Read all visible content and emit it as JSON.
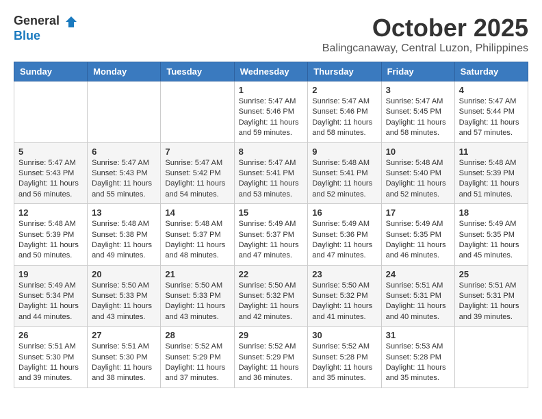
{
  "logo": {
    "text_general": "General",
    "text_blue": "Blue"
  },
  "title": {
    "month": "October 2025",
    "location": "Balingcanaway, Central Luzon, Philippines"
  },
  "headers": [
    "Sunday",
    "Monday",
    "Tuesday",
    "Wednesday",
    "Thursday",
    "Friday",
    "Saturday"
  ],
  "weeks": [
    [
      {
        "day": "",
        "sunrise": "",
        "sunset": "",
        "daylight": ""
      },
      {
        "day": "",
        "sunrise": "",
        "sunset": "",
        "daylight": ""
      },
      {
        "day": "",
        "sunrise": "",
        "sunset": "",
        "daylight": ""
      },
      {
        "day": "1",
        "sunrise": "Sunrise: 5:47 AM",
        "sunset": "Sunset: 5:46 PM",
        "daylight": "Daylight: 11 hours and 59 minutes."
      },
      {
        "day": "2",
        "sunrise": "Sunrise: 5:47 AM",
        "sunset": "Sunset: 5:46 PM",
        "daylight": "Daylight: 11 hours and 58 minutes."
      },
      {
        "day": "3",
        "sunrise": "Sunrise: 5:47 AM",
        "sunset": "Sunset: 5:45 PM",
        "daylight": "Daylight: 11 hours and 58 minutes."
      },
      {
        "day": "4",
        "sunrise": "Sunrise: 5:47 AM",
        "sunset": "Sunset: 5:44 PM",
        "daylight": "Daylight: 11 hours and 57 minutes."
      }
    ],
    [
      {
        "day": "5",
        "sunrise": "Sunrise: 5:47 AM",
        "sunset": "Sunset: 5:43 PM",
        "daylight": "Daylight: 11 hours and 56 minutes."
      },
      {
        "day": "6",
        "sunrise": "Sunrise: 5:47 AM",
        "sunset": "Sunset: 5:43 PM",
        "daylight": "Daylight: 11 hours and 55 minutes."
      },
      {
        "day": "7",
        "sunrise": "Sunrise: 5:47 AM",
        "sunset": "Sunset: 5:42 PM",
        "daylight": "Daylight: 11 hours and 54 minutes."
      },
      {
        "day": "8",
        "sunrise": "Sunrise: 5:47 AM",
        "sunset": "Sunset: 5:41 PM",
        "daylight": "Daylight: 11 hours and 53 minutes."
      },
      {
        "day": "9",
        "sunrise": "Sunrise: 5:48 AM",
        "sunset": "Sunset: 5:41 PM",
        "daylight": "Daylight: 11 hours and 52 minutes."
      },
      {
        "day": "10",
        "sunrise": "Sunrise: 5:48 AM",
        "sunset": "Sunset: 5:40 PM",
        "daylight": "Daylight: 11 hours and 52 minutes."
      },
      {
        "day": "11",
        "sunrise": "Sunrise: 5:48 AM",
        "sunset": "Sunset: 5:39 PM",
        "daylight": "Daylight: 11 hours and 51 minutes."
      }
    ],
    [
      {
        "day": "12",
        "sunrise": "Sunrise: 5:48 AM",
        "sunset": "Sunset: 5:39 PM",
        "daylight": "Daylight: 11 hours and 50 minutes."
      },
      {
        "day": "13",
        "sunrise": "Sunrise: 5:48 AM",
        "sunset": "Sunset: 5:38 PM",
        "daylight": "Daylight: 11 hours and 49 minutes."
      },
      {
        "day": "14",
        "sunrise": "Sunrise: 5:48 AM",
        "sunset": "Sunset: 5:37 PM",
        "daylight": "Daylight: 11 hours and 48 minutes."
      },
      {
        "day": "15",
        "sunrise": "Sunrise: 5:49 AM",
        "sunset": "Sunset: 5:37 PM",
        "daylight": "Daylight: 11 hours and 47 minutes."
      },
      {
        "day": "16",
        "sunrise": "Sunrise: 5:49 AM",
        "sunset": "Sunset: 5:36 PM",
        "daylight": "Daylight: 11 hours and 47 minutes."
      },
      {
        "day": "17",
        "sunrise": "Sunrise: 5:49 AM",
        "sunset": "Sunset: 5:35 PM",
        "daylight": "Daylight: 11 hours and 46 minutes."
      },
      {
        "day": "18",
        "sunrise": "Sunrise: 5:49 AM",
        "sunset": "Sunset: 5:35 PM",
        "daylight": "Daylight: 11 hours and 45 minutes."
      }
    ],
    [
      {
        "day": "19",
        "sunrise": "Sunrise: 5:49 AM",
        "sunset": "Sunset: 5:34 PM",
        "daylight": "Daylight: 11 hours and 44 minutes."
      },
      {
        "day": "20",
        "sunrise": "Sunrise: 5:50 AM",
        "sunset": "Sunset: 5:33 PM",
        "daylight": "Daylight: 11 hours and 43 minutes."
      },
      {
        "day": "21",
        "sunrise": "Sunrise: 5:50 AM",
        "sunset": "Sunset: 5:33 PM",
        "daylight": "Daylight: 11 hours and 43 minutes."
      },
      {
        "day": "22",
        "sunrise": "Sunrise: 5:50 AM",
        "sunset": "Sunset: 5:32 PM",
        "daylight": "Daylight: 11 hours and 42 minutes."
      },
      {
        "day": "23",
        "sunrise": "Sunrise: 5:50 AM",
        "sunset": "Sunset: 5:32 PM",
        "daylight": "Daylight: 11 hours and 41 minutes."
      },
      {
        "day": "24",
        "sunrise": "Sunrise: 5:51 AM",
        "sunset": "Sunset: 5:31 PM",
        "daylight": "Daylight: 11 hours and 40 minutes."
      },
      {
        "day": "25",
        "sunrise": "Sunrise: 5:51 AM",
        "sunset": "Sunset: 5:31 PM",
        "daylight": "Daylight: 11 hours and 39 minutes."
      }
    ],
    [
      {
        "day": "26",
        "sunrise": "Sunrise: 5:51 AM",
        "sunset": "Sunset: 5:30 PM",
        "daylight": "Daylight: 11 hours and 39 minutes."
      },
      {
        "day": "27",
        "sunrise": "Sunrise: 5:51 AM",
        "sunset": "Sunset: 5:30 PM",
        "daylight": "Daylight: 11 hours and 38 minutes."
      },
      {
        "day": "28",
        "sunrise": "Sunrise: 5:52 AM",
        "sunset": "Sunset: 5:29 PM",
        "daylight": "Daylight: 11 hours and 37 minutes."
      },
      {
        "day": "29",
        "sunrise": "Sunrise: 5:52 AM",
        "sunset": "Sunset: 5:29 PM",
        "daylight": "Daylight: 11 hours and 36 minutes."
      },
      {
        "day": "30",
        "sunrise": "Sunrise: 5:52 AM",
        "sunset": "Sunset: 5:28 PM",
        "daylight": "Daylight: 11 hours and 35 minutes."
      },
      {
        "day": "31",
        "sunrise": "Sunrise: 5:53 AM",
        "sunset": "Sunset: 5:28 PM",
        "daylight": "Daylight: 11 hours and 35 minutes."
      },
      {
        "day": "",
        "sunrise": "",
        "sunset": "",
        "daylight": ""
      }
    ]
  ]
}
